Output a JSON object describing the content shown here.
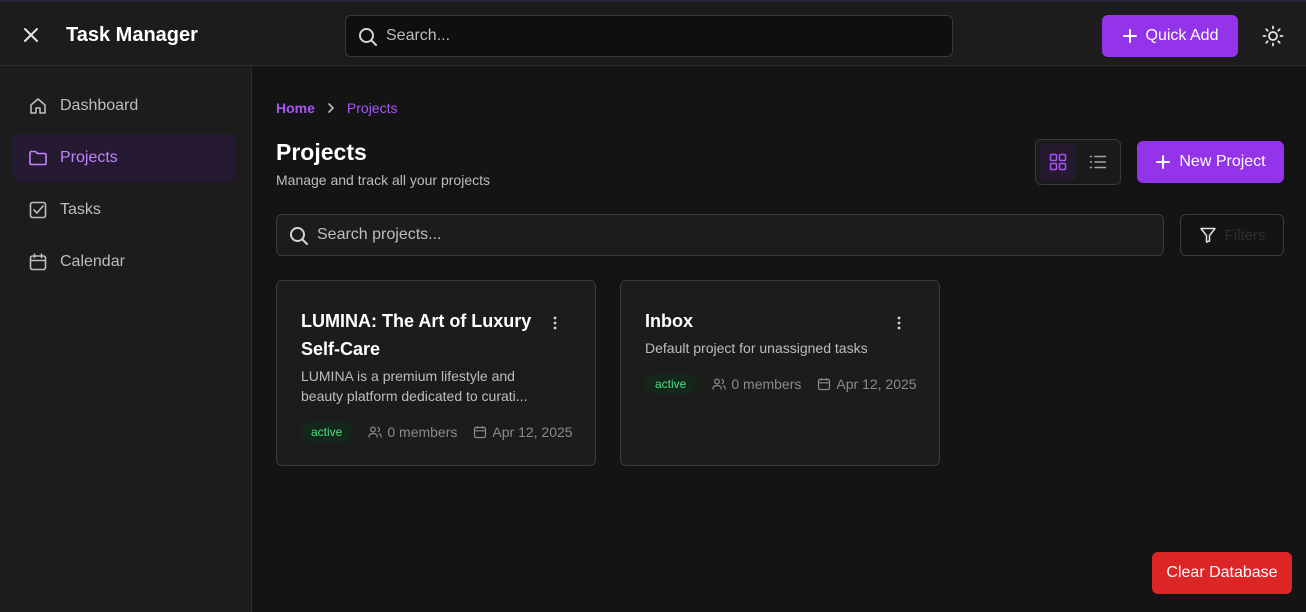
{
  "header": {
    "app_title": "Task Manager",
    "search_placeholder": "Search...",
    "quick_add_label": "Quick Add"
  },
  "sidebar": {
    "items": [
      {
        "label": "Dashboard",
        "icon": "home-icon",
        "active": false
      },
      {
        "label": "Projects",
        "icon": "folder-icon",
        "active": true
      },
      {
        "label": "Tasks",
        "icon": "check-square-icon",
        "active": false
      },
      {
        "label": "Calendar",
        "icon": "calendar-icon",
        "active": false
      }
    ]
  },
  "breadcrumb": {
    "home": "Home",
    "current": "Projects"
  },
  "page": {
    "title": "Projects",
    "subtitle": "Manage and track all your projects",
    "new_project_label": "New Project",
    "search_placeholder": "Search projects...",
    "filters_label": "Filters"
  },
  "projects": [
    {
      "title": "LUMINA: The Art of Luxury Self-Care",
      "description": "LUMINA is a premium lifestyle and beauty platform dedicated to curati...",
      "status": "active",
      "members": "0 members",
      "date": "Apr 12, 2025"
    },
    {
      "title": "Inbox",
      "description": "Default project for unassigned tasks",
      "status": "active",
      "members": "0 members",
      "date": "Apr 12, 2025"
    }
  ],
  "footer": {
    "clear_db_label": "Clear Database"
  },
  "colors": {
    "accent": "#9333ea",
    "accent_text": "#a855f7",
    "danger": "#dc2626",
    "status_active": "#4ade80"
  }
}
